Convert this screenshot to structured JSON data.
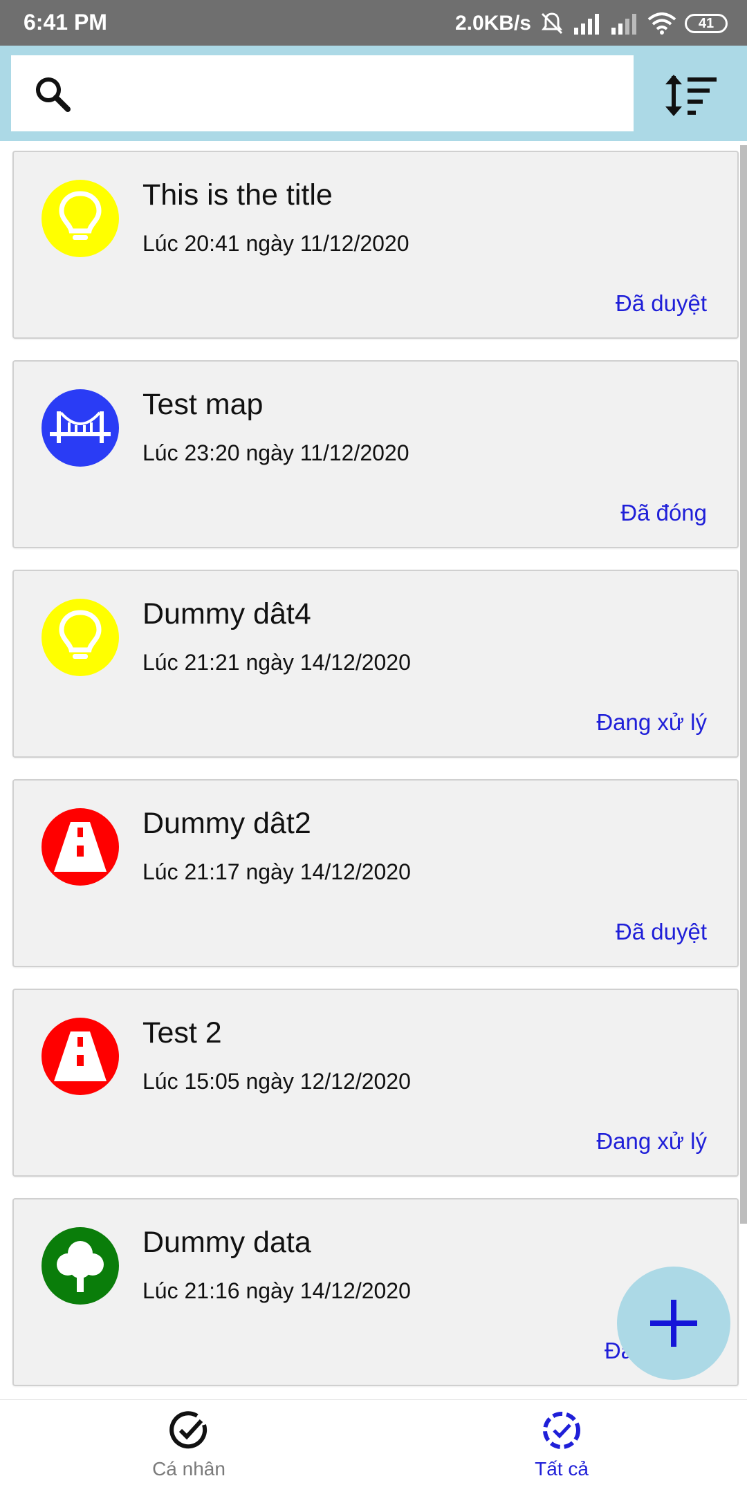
{
  "status_bar": {
    "time": "6:41 PM",
    "net_speed": "2.0KB/s",
    "battery": "41"
  },
  "search": {
    "value": "",
    "placeholder": ""
  },
  "items": [
    {
      "title": "This is the title",
      "time": "Lúc 20:41 ngày 11/12/2020",
      "status": "Đã duyệt",
      "icon": "lightbulb-icon",
      "color": "#ffff00"
    },
    {
      "title": "Test map",
      "time": "Lúc 23:20 ngày 11/12/2020",
      "status": "Đã đóng",
      "icon": "bridge-icon",
      "color": "#2a3cf5"
    },
    {
      "title": "Dummy dât4",
      "time": "Lúc 21:21 ngày 14/12/2020",
      "status": "Đang xử lý",
      "icon": "lightbulb-icon",
      "color": "#ffff00"
    },
    {
      "title": "Dummy dât2",
      "time": "Lúc 21:17 ngày 14/12/2020",
      "status": "Đã duyệt",
      "icon": "road-icon",
      "color": "#ff0000"
    },
    {
      "title": "Test 2",
      "time": "Lúc 15:05 ngày 12/12/2020",
      "status": "Đang xử lý",
      "icon": "road-icon",
      "color": "#ff0000"
    },
    {
      "title": "Dummy data",
      "time": "Lúc 21:16 ngày 14/12/2020",
      "status": "Đa",
      "icon": "tree-icon",
      "color": "#0a7d0a"
    }
  ],
  "bottom_nav": {
    "personal_label": "Cá nhân",
    "all_label": "Tất cả"
  },
  "colors": {
    "accent": "#1f1fd8",
    "appbar": "#acd9e6"
  }
}
